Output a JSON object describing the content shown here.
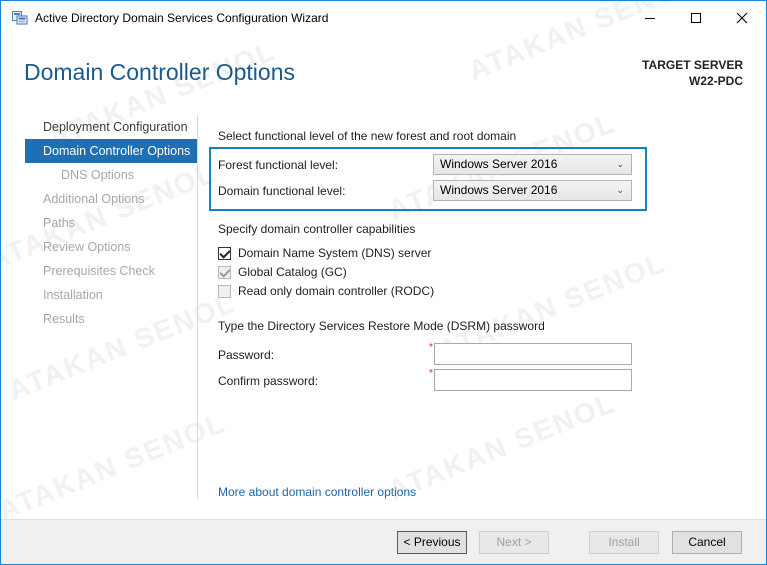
{
  "window": {
    "title": "Active Directory Domain Services Configuration Wizard"
  },
  "header": {
    "page_title": "Domain Controller Options",
    "target_label": "TARGET SERVER",
    "target_name": "W22-PDC"
  },
  "nav": {
    "items": [
      {
        "label": "Deployment Configuration",
        "state": "done"
      },
      {
        "label": "Domain Controller Options",
        "state": "active"
      },
      {
        "label": "DNS Options",
        "state": "pending-sub"
      },
      {
        "label": "Additional Options",
        "state": "pending"
      },
      {
        "label": "Paths",
        "state": "pending"
      },
      {
        "label": "Review Options",
        "state": "pending"
      },
      {
        "label": "Prerequisites Check",
        "state": "pending"
      },
      {
        "label": "Installation",
        "state": "pending"
      },
      {
        "label": "Results",
        "state": "pending"
      }
    ]
  },
  "functional_level": {
    "heading": "Select functional level of the new forest and root domain",
    "forest_label": "Forest functional level:",
    "forest_value": "Windows Server 2016",
    "domain_label": "Domain functional level:",
    "domain_value": "Windows Server 2016"
  },
  "capabilities": {
    "heading": "Specify domain controller capabilities",
    "items": [
      {
        "label": "Domain Name System (DNS) server",
        "checked": true,
        "enabled": true
      },
      {
        "label": "Global Catalog (GC)",
        "checked": true,
        "enabled": false
      },
      {
        "label": "Read only domain controller (RODC)",
        "checked": false,
        "enabled": false
      }
    ]
  },
  "dsrm": {
    "heading": "Type the Directory Services Restore Mode (DSRM) password",
    "password_label": "Password:",
    "password_value": "",
    "confirm_label": "Confirm password:",
    "confirm_value": "",
    "required_marker": "*"
  },
  "links": {
    "more": "More about domain controller options"
  },
  "footer": {
    "previous": "< Previous",
    "next": "Next >",
    "install": "Install",
    "cancel": "Cancel"
  },
  "watermark": {
    "text": "ATAKAN SENOL"
  },
  "colors": {
    "accent": "#1e6fb3",
    "title": "#1c5a8c",
    "highlight_border": "#1a7fc1",
    "link": "#1a66b0"
  }
}
